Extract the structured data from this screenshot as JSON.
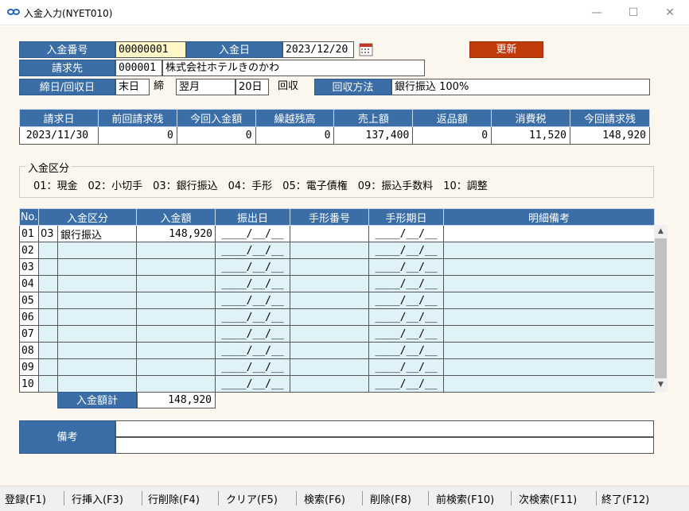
{
  "window": {
    "title": "入金入力(NYET010)",
    "minimize": "—",
    "maximize": "☐",
    "close": "✕"
  },
  "header": {
    "nyukin_no_label": "入金番号",
    "nyukin_no_value": "00000001",
    "nyukin_date_label": "入金日",
    "nyukin_date_value": "2023/12/20",
    "update_button": "更新",
    "seikyusaki_label": "請求先",
    "seikyusaki_code": "000001",
    "seikyusaki_name": "株式会社ホテルきのかわ",
    "shime_label": "締日/回収日",
    "shime_value": "末日",
    "shime_suffix": "締",
    "kaishu_month": "翌月",
    "kaishu_day": "20日",
    "kaishu_suffix": "回収",
    "kaishu_method_label": "回収方法",
    "kaishu_method_value": "銀行振込 100%"
  },
  "summary": {
    "headers": [
      "請求日",
      "前回請求残",
      "今回入金額",
      "繰越残高",
      "売上額",
      "返品額",
      "消費税",
      "今回請求残"
    ],
    "values": [
      "2023/11/30",
      "0",
      "0",
      "0",
      "137,400",
      "0",
      "11,520",
      "148,920"
    ]
  },
  "kubun": {
    "title": "入金区分",
    "items": "01：現金　02：小切手　03：銀行振込　04：手形　05：電子債権　09：振込手数料　10：調整"
  },
  "grid": {
    "headers": [
      "No.",
      "入金区分",
      "入金額",
      "振出日",
      "手形番号",
      "手形期日",
      "明細備考"
    ],
    "rows": [
      {
        "no": "01",
        "code": "03",
        "kubun": "銀行振込",
        "amount": "148,920",
        "furidashi": "____/__/__",
        "tegata_no": "",
        "kijitsu": "____/__/__",
        "biko": ""
      },
      {
        "no": "02",
        "code": "",
        "kubun": "",
        "amount": "",
        "furidashi": "____/__/__",
        "tegata_no": "",
        "kijitsu": "____/__/__",
        "biko": ""
      },
      {
        "no": "03",
        "code": "",
        "kubun": "",
        "amount": "",
        "furidashi": "____/__/__",
        "tegata_no": "",
        "kijitsu": "____/__/__",
        "biko": ""
      },
      {
        "no": "04",
        "code": "",
        "kubun": "",
        "amount": "",
        "furidashi": "____/__/__",
        "tegata_no": "",
        "kijitsu": "____/__/__",
        "biko": ""
      },
      {
        "no": "05",
        "code": "",
        "kubun": "",
        "amount": "",
        "furidashi": "____/__/__",
        "tegata_no": "",
        "kijitsu": "____/__/__",
        "biko": ""
      },
      {
        "no": "06",
        "code": "",
        "kubun": "",
        "amount": "",
        "furidashi": "____/__/__",
        "tegata_no": "",
        "kijitsu": "____/__/__",
        "biko": ""
      },
      {
        "no": "07",
        "code": "",
        "kubun": "",
        "amount": "",
        "furidashi": "____/__/__",
        "tegata_no": "",
        "kijitsu": "____/__/__",
        "biko": ""
      },
      {
        "no": "08",
        "code": "",
        "kubun": "",
        "amount": "",
        "furidashi": "____/__/__",
        "tegata_no": "",
        "kijitsu": "____/__/__",
        "biko": ""
      },
      {
        "no": "09",
        "code": "",
        "kubun": "",
        "amount": "",
        "furidashi": "____/__/__",
        "tegata_no": "",
        "kijitsu": "____/__/__",
        "biko": ""
      },
      {
        "no": "10",
        "code": "",
        "kubun": "",
        "amount": "",
        "furidashi": "____/__/__",
        "tegata_no": "",
        "kijitsu": "____/__/__",
        "biko": ""
      }
    ],
    "total_label": "入金額計",
    "total_value": "148,920"
  },
  "remarks": {
    "label": "備考"
  },
  "fkeys": [
    "登録(F1)",
    "行挿入(F3)",
    "行削除(F4)",
    "クリア(F5)",
    "検索(F6)",
    "削除(F8)",
    "前検索(F10)",
    "次検索(F11)",
    "終了(F12)"
  ],
  "colors": {
    "header_blue": "#3b6ea6",
    "update_red": "#c23b0a",
    "row_cyan": "#dff2f7",
    "background": "#fbf7ee"
  }
}
